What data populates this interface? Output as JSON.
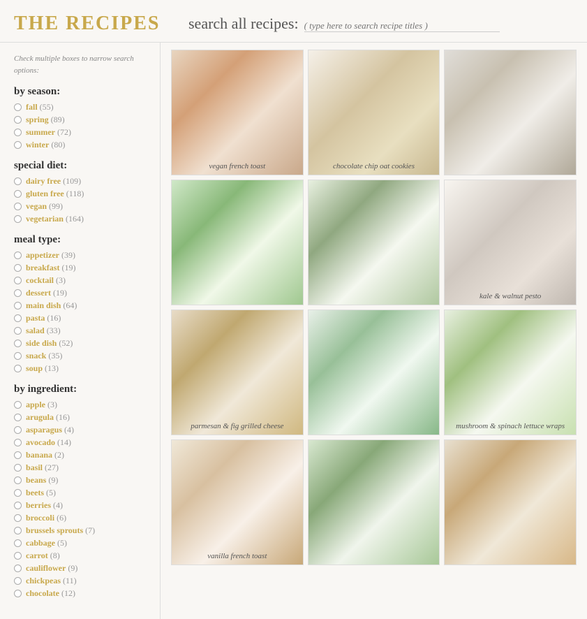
{
  "header": {
    "title": "THE RECIPES",
    "search_label": "search all recipes:",
    "search_placeholder": "( type here to search recipe titles )"
  },
  "sidebar": {
    "hint": "Check multiple boxes to narrow search options:",
    "sections": [
      {
        "id": "by-season",
        "heading": "by season:",
        "items": [
          {
            "name": "fall",
            "count": "(55)"
          },
          {
            "name": "spring",
            "count": "(89)"
          },
          {
            "name": "summer",
            "count": "(72)"
          },
          {
            "name": "winter",
            "count": "(80)"
          }
        ]
      },
      {
        "id": "special-diet",
        "heading": "special diet:",
        "items": [
          {
            "name": "dairy free",
            "count": "(109)"
          },
          {
            "name": "gluten free",
            "count": "(118)"
          },
          {
            "name": "vegan",
            "count": "(99)"
          },
          {
            "name": "vegetarian",
            "count": "(164)"
          }
        ]
      },
      {
        "id": "meal-type",
        "heading": "meal type:",
        "items": [
          {
            "name": "appetizer",
            "count": "(39)"
          },
          {
            "name": "breakfast",
            "count": "(19)"
          },
          {
            "name": "cocktail",
            "count": "(3)"
          },
          {
            "name": "dessert",
            "count": "(19)"
          },
          {
            "name": "main dish",
            "count": "(64)"
          },
          {
            "name": "pasta",
            "count": "(16)"
          },
          {
            "name": "salad",
            "count": "(33)"
          },
          {
            "name": "side dish",
            "count": "(52)"
          },
          {
            "name": "snack",
            "count": "(35)"
          },
          {
            "name": "soup",
            "count": "(13)"
          }
        ]
      },
      {
        "id": "by-ingredient",
        "heading": "by ingredient:",
        "items": [
          {
            "name": "apple",
            "count": "(3)"
          },
          {
            "name": "arugula",
            "count": "(16)"
          },
          {
            "name": "asparagus",
            "count": "(4)"
          },
          {
            "name": "avocado",
            "count": "(14)"
          },
          {
            "name": "banana",
            "count": "(2)"
          },
          {
            "name": "basil",
            "count": "(27)"
          },
          {
            "name": "beans",
            "count": "(9)"
          },
          {
            "name": "beets",
            "count": "(5)"
          },
          {
            "name": "berries",
            "count": "(4)"
          },
          {
            "name": "broccoli",
            "count": "(6)"
          },
          {
            "name": "brussels sprouts",
            "count": "(7)"
          },
          {
            "name": "cabbage",
            "count": "(5)"
          },
          {
            "name": "carrot",
            "count": "(8)"
          },
          {
            "name": "cauliflower",
            "count": "(9)"
          },
          {
            "name": "chickpeas",
            "count": "(11)"
          },
          {
            "name": "chocolate",
            "count": "(12)"
          }
        ]
      }
    ]
  },
  "recipes": [
    {
      "id": 1,
      "label": "vegan french toast",
      "card_class": "card-1"
    },
    {
      "id": 2,
      "label": "chocolate chip oat cookies",
      "card_class": "card-2"
    },
    {
      "id": 3,
      "label": "",
      "card_class": "card-3"
    },
    {
      "id": 4,
      "label": "",
      "card_class": "card-4"
    },
    {
      "id": 5,
      "label": "",
      "card_class": "card-5"
    },
    {
      "id": 6,
      "label": "kale & walnut pesto",
      "card_class": "card-6"
    },
    {
      "id": 7,
      "label": "parmesan & fig grilled cheese",
      "card_class": "card-7"
    },
    {
      "id": 8,
      "label": "",
      "card_class": "card-8"
    },
    {
      "id": 9,
      "label": "mushroom & spinach lettuce wraps",
      "card_class": "card-9"
    },
    {
      "id": 10,
      "label": "vanilla french toast",
      "card_class": "card-10"
    },
    {
      "id": 11,
      "label": "",
      "card_class": "card-11"
    },
    {
      "id": 12,
      "label": "",
      "card_class": "card-12"
    }
  ]
}
